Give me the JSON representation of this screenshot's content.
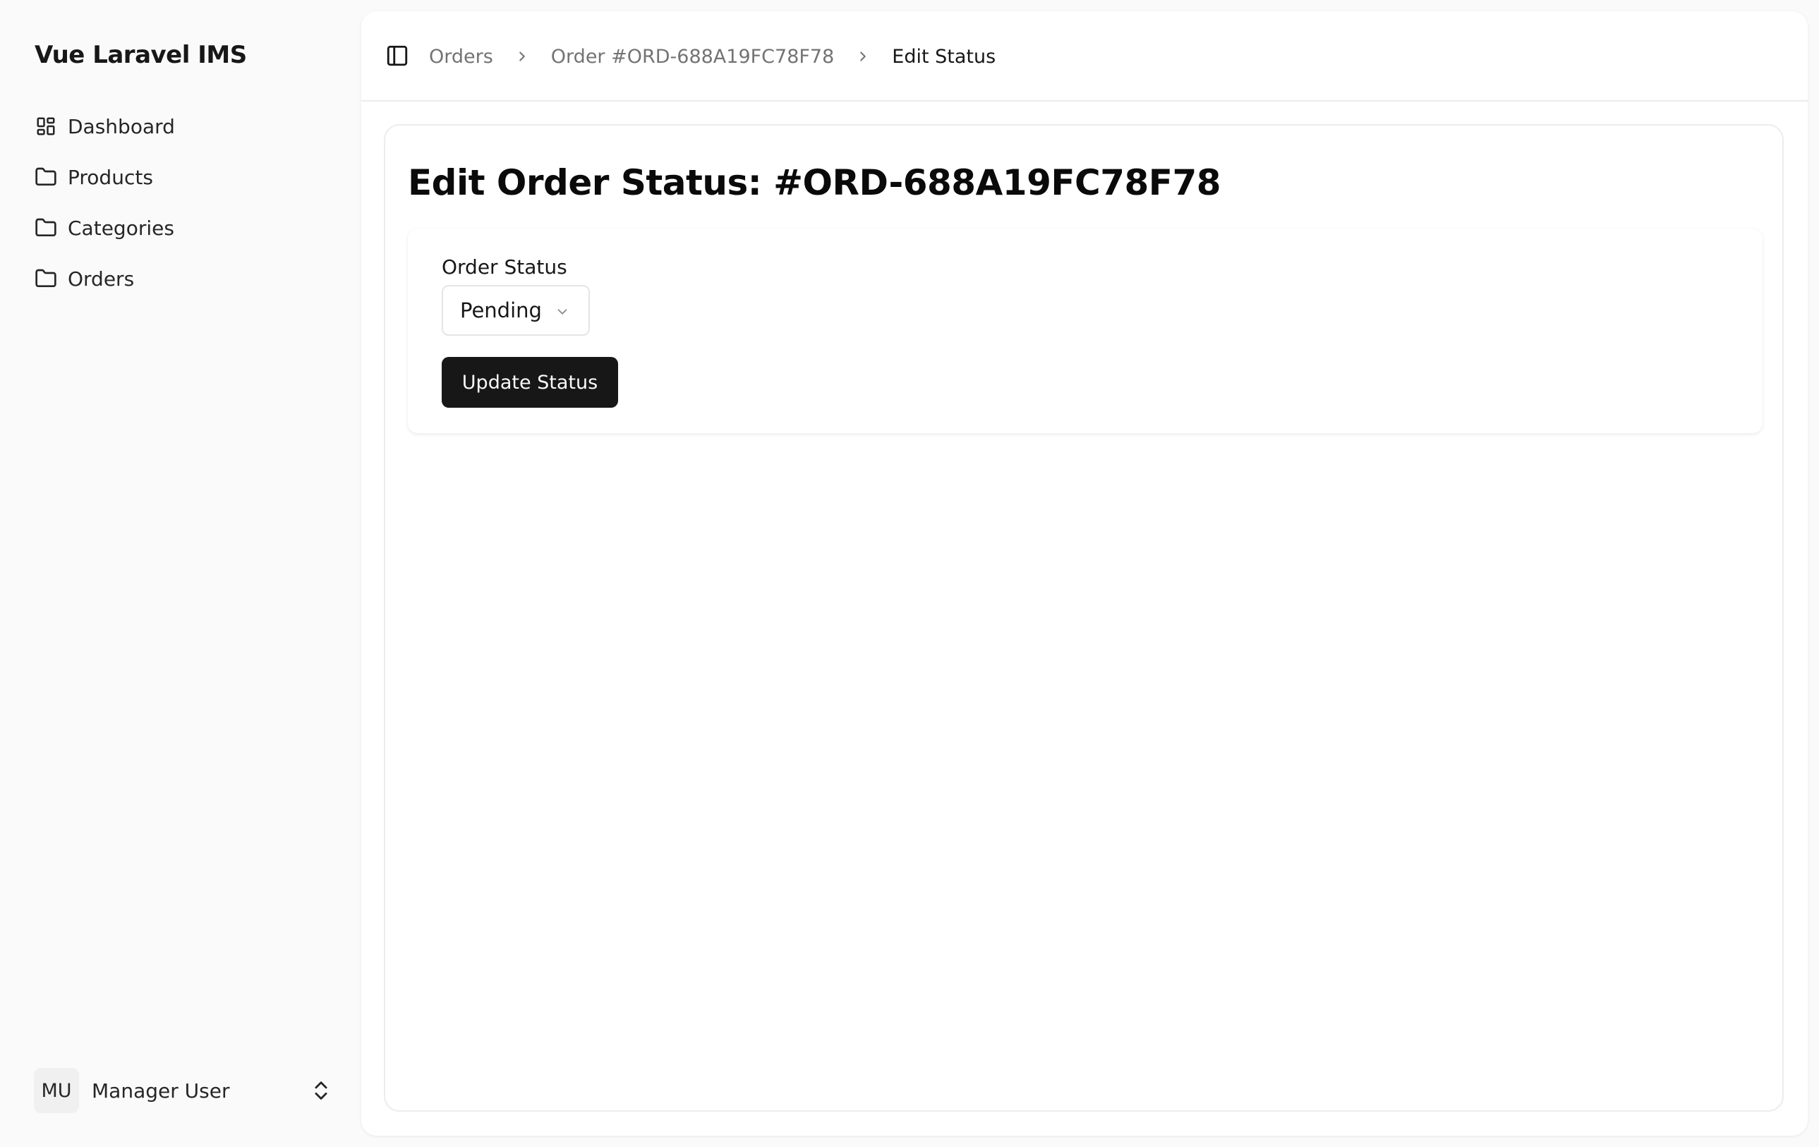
{
  "app": {
    "title": "Vue Laravel IMS"
  },
  "sidebar": {
    "items": [
      {
        "label": "Dashboard",
        "icon": "dashboard-grid-icon"
      },
      {
        "label": "Products",
        "icon": "folder-icon"
      },
      {
        "label": "Categories",
        "icon": "folder-icon"
      },
      {
        "label": "Orders",
        "icon": "folder-icon"
      }
    ],
    "user": {
      "initials": "MU",
      "name": "Manager User",
      "icon": "chevrons-up-down-icon"
    }
  },
  "topbar": {
    "toggle_icon": "sidebar-toggle-icon",
    "breadcrumb": [
      "Orders",
      "Order #ORD-688A19FC78F78",
      "Edit Status"
    ]
  },
  "page": {
    "title": "Edit Order Status: #ORD-688A19FC78F78",
    "form": {
      "status_label": "Order Status",
      "status_value": "Pending",
      "submit_label": "Update Status"
    }
  },
  "colors": {
    "primary_button": "#171717",
    "sidebar_bg": "#fafafa",
    "panel_bg": "#ffffff"
  }
}
